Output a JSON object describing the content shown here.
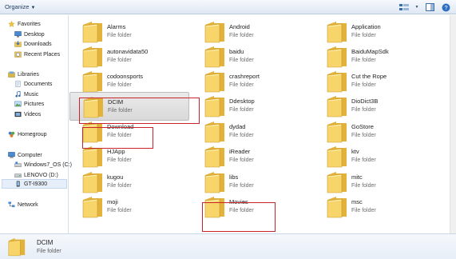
{
  "toolbar": {
    "organize_label": "Organize",
    "icons": [
      "views-icon",
      "preview-pane-icon",
      "help-icon"
    ]
  },
  "nav": {
    "favorites": {
      "label": "Favorites",
      "items": [
        "Desktop",
        "Downloads",
        "Recent Places"
      ]
    },
    "libraries": {
      "label": "Libraries",
      "items": [
        "Documents",
        "Music",
        "Pictures",
        "Videos"
      ]
    },
    "homegroup": "Homegroup",
    "computer": {
      "label": "Computer",
      "items": [
        "Windows7_OS (C:)",
        "LENOVO (D:)",
        "GT-I9300"
      ]
    },
    "network": "Network",
    "selected_item": "GT-I9300"
  },
  "files": {
    "items": [
      {
        "name": "Alarms",
        "type": "File folder"
      },
      {
        "name": "Android",
        "type": "File folder"
      },
      {
        "name": "Application",
        "type": "File folder"
      },
      {
        "name": "autonavidata50",
        "type": "File folder"
      },
      {
        "name": "baidu",
        "type": "File folder"
      },
      {
        "name": "BaiduMapSdk",
        "type": "File folder"
      },
      {
        "name": "codoonsports",
        "type": "File folder"
      },
      {
        "name": "crashreport",
        "type": "File folder"
      },
      {
        "name": "Cut the Rope",
        "type": "File folder"
      },
      {
        "name": "DCIM",
        "type": "File folder"
      },
      {
        "name": "Ddesktop",
        "type": "File folder"
      },
      {
        "name": "DioDict3B",
        "type": "File folder"
      },
      {
        "name": "Download",
        "type": "File folder"
      },
      {
        "name": "dydad",
        "type": "File folder"
      },
      {
        "name": "GoStore",
        "type": "File folder"
      },
      {
        "name": "HJApp",
        "type": "File folder"
      },
      {
        "name": "iReader",
        "type": "File folder"
      },
      {
        "name": "ktv",
        "type": "File folder"
      },
      {
        "name": "kugou",
        "type": "File folder"
      },
      {
        "name": "libs",
        "type": "File folder"
      },
      {
        "name": "mitc",
        "type": "File folder"
      },
      {
        "name": "moji",
        "type": "File folder"
      },
      {
        "name": "Movies",
        "type": "File folder"
      },
      {
        "name": "msc",
        "type": "File folder"
      }
    ],
    "selected": "DCIM",
    "highlighted": [
      "DCIM",
      "Download",
      "Movies"
    ]
  },
  "details": {
    "name": "DCIM",
    "type": "File folder"
  },
  "colors": {
    "highlight_box": "#c8242b",
    "folder": "#f0c64a"
  }
}
